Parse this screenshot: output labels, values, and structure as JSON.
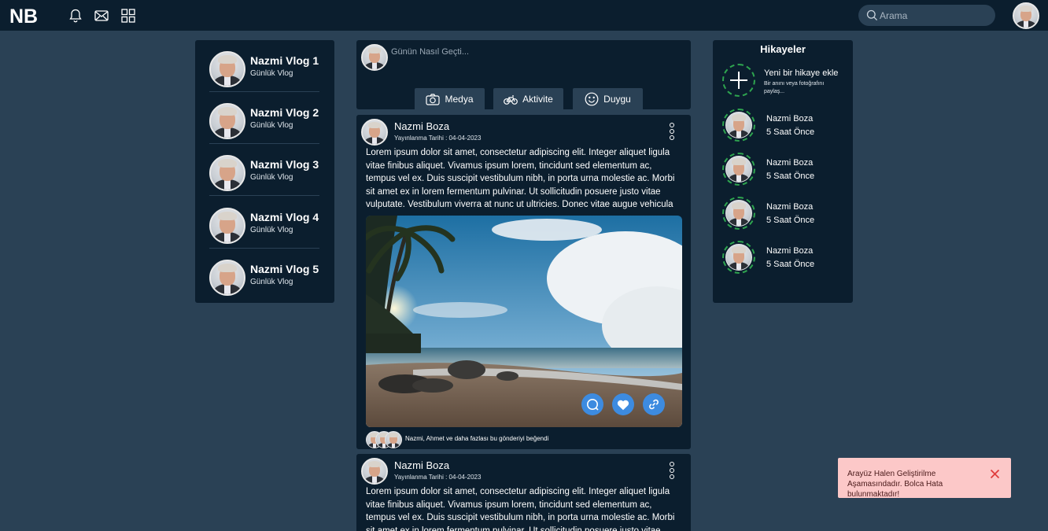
{
  "header": {
    "logo": "NB",
    "search_placeholder": "Arama",
    "icons": [
      "bell-icon",
      "mail-icon",
      "grid-icon"
    ]
  },
  "vlogs": [
    {
      "title": "Nazmi Vlog 1",
      "subtitle": "Günlük Vlog"
    },
    {
      "title": "Nazmi Vlog 2",
      "subtitle": "Günlük Vlog"
    },
    {
      "title": "Nazmi Vlog 3",
      "subtitle": "Günlük Vlog"
    },
    {
      "title": "Nazmi Vlog 4",
      "subtitle": "Günlük Vlog"
    },
    {
      "title": "Nazmi Vlog 5",
      "subtitle": "Günlük Vlog"
    }
  ],
  "composer": {
    "placeholder": "Günün Nasıl Geçti...",
    "media_label": "Medya",
    "activity_label": "Aktivite",
    "mood_label": "Duygu"
  },
  "posts": [
    {
      "author": "Nazmi Boza",
      "date": "Yayınlanma Tarihi : 04-04-2023",
      "text": "Lorem ipsum dolor sit amet, consectetur adipiscing elit. Integer aliquet ligula vitae finibus aliquet. Vivamus ipsum lorem, tincidunt sed elementum ac, tempus vel ex. Duis suscipit vestibulum nibh, in porta urna molestie ac. Morbi sit amet ex in lorem fermentum pulvinar. Ut sollicitudin posuere justo vitae vulputate. Vestibulum viverra at nunc ut ultricies. Donec vitae augue vehicula",
      "likes_text": "Nazmi, Ahmet ve daha fazlası bu gönderiyi beğendi"
    },
    {
      "author": "Nazmi Boza",
      "date": "Yayınlanma Tarihi : 04-04-2023",
      "text": "Lorem ipsum dolor sit amet, consectetur adipiscing elit. Integer aliquet ligula vitae finibus aliquet. Vivamus ipsum lorem, tincidunt sed elementum ac, tempus vel ex. Duis suscipit vestibulum nibh, in porta urna molestie ac. Morbi sit amet ex in lorem fermentum pulvinar. Ut sollicitudin posuere justo vitae vulputate."
    }
  ],
  "stories": {
    "title": "Hikayeler",
    "add_title": "Yeni bir hikaye ekle",
    "add_subtitle": "Bir anını veya fotoğrafını paylaş...",
    "items": [
      {
        "name": "Nazmi Boza",
        "time": "5 Saat Önce"
      },
      {
        "name": "Nazmi Boza",
        "time": "5 Saat Önce"
      },
      {
        "name": "Nazmi Boza",
        "time": "5 Saat Önce"
      },
      {
        "name": "Nazmi Boza",
        "time": "5 Saat Önce"
      }
    ]
  },
  "toast": {
    "message": "Arayüz Halen Geliştirilme Aşamasındadır. Bolca Hata bulunmaktadır!"
  },
  "colors": {
    "background": "#2a4155",
    "panel": "#0b1e2e",
    "accent_blue": "#3d8be0",
    "story_ring": "#2ea44f",
    "toast_bg": "#fcc8c8",
    "toast_close": "#e03c3c"
  }
}
